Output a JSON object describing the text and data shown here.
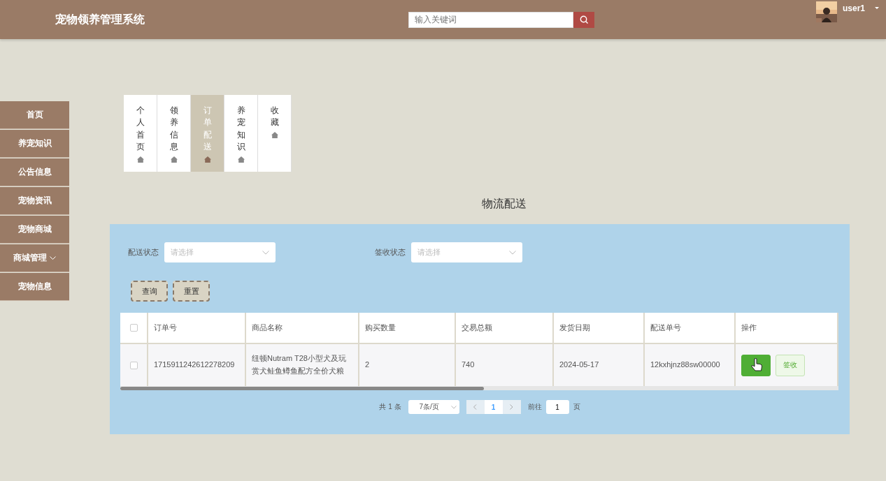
{
  "header": {
    "title": "宠物领养管理系统",
    "search": {
      "placeholder": "输入关键词"
    },
    "user": {
      "name": "user1"
    }
  },
  "sidebar": {
    "items": [
      {
        "label": "首页",
        "has_submenu": false
      },
      {
        "label": "养宠知识",
        "has_submenu": false
      },
      {
        "label": "公告信息",
        "has_submenu": false
      },
      {
        "label": "宠物资讯",
        "has_submenu": false
      },
      {
        "label": "宠物商城",
        "has_submenu": false
      },
      {
        "label": "商城管理",
        "has_submenu": true
      },
      {
        "label": "宠物信息",
        "has_submenu": false
      }
    ]
  },
  "tabs": [
    {
      "label": "个人首页",
      "selected": false
    },
    {
      "label": "领养信息",
      "selected": false
    },
    {
      "label": "订单配送",
      "selected": true
    },
    {
      "label": "养宠知识",
      "selected": false
    },
    {
      "label": "收藏",
      "selected": false
    }
  ],
  "page_title": "物流配送",
  "filters": [
    {
      "label": "配送状态",
      "placeholder": "请选择"
    },
    {
      "label": "签收状态",
      "placeholder": "请选择"
    }
  ],
  "filter_buttons": [
    "查询",
    "重置"
  ],
  "table": {
    "all_checked": false,
    "columns": [
      "订单号",
      "商品名称",
      "购买数量",
      "交易总额",
      "发货日期",
      "配送单号",
      "操作"
    ],
    "rows": [
      {
        "checked": false,
        "cells": [
          "1715911242612278209",
          "纽顿Nutram T28小型犬及玩赏犬鲑鱼鳟鱼配方全价犬粮",
          "2",
          "740",
          "2024-05-17",
          "12kxhjnz88sw00000"
        ],
        "actions": [
          {
            "kind": "primary"
          },
          {
            "kind": "plain",
            "label": "签收"
          }
        ]
      }
    ]
  },
  "pagination": {
    "total": "共 1 条",
    "page_size": "7条/页",
    "pages": [
      {
        "label": "1",
        "selected": true
      }
    ],
    "goto_label": "前往",
    "goto_value": "1",
    "goto_suffix": "页"
  }
}
